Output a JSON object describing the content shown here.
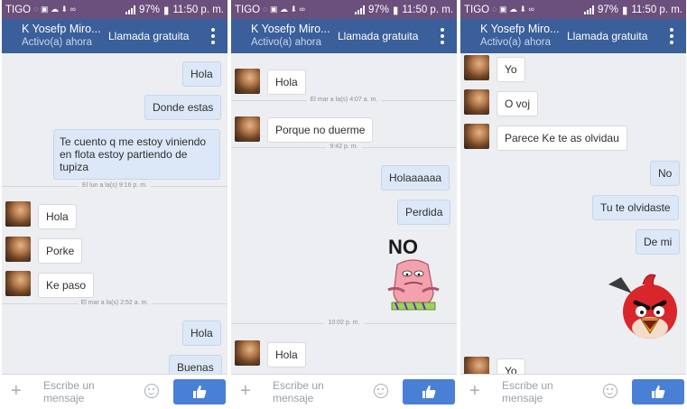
{
  "status_bar": {
    "carrier": "TIGO",
    "battery": "97%",
    "time": "11:50 p. m."
  },
  "header": {
    "name": "K Yosefp Miro...",
    "status": "Activo(a) ahora",
    "call": "Llamada gratuita"
  },
  "input": {
    "placeholder_line1": "Escribe un",
    "placeholder_line2": "mensaje"
  },
  "panel1": {
    "out_1": "Hola",
    "out_2": "Donde estas",
    "out_3": "Te cuento q me estoy viniendo en flota estoy partiendo de tupiza",
    "divider_1": "El lun a la(s) 9:16 p. m.",
    "in_1": "Hola",
    "in_2": "Porke",
    "in_3": "Ke paso",
    "divider_2": "El mar a la(s) 2:52 a. m.",
    "out_4": "Hola",
    "out_5": "Buenas"
  },
  "panel2": {
    "in_1": "Hola",
    "divider_1": "El mar a la(s) 4:07 a. m.",
    "in_2": "Porque no duerme",
    "divider_2": "9:42 p. m.",
    "out_1": "Holaaaaaa",
    "out_2": "Perdida",
    "sticker_text": "NO",
    "divider_3": "10:02 p. m.",
    "in_3": "Hola"
  },
  "panel3": {
    "in_1": "Yo",
    "in_2": "O voj",
    "in_3": "Parece Ke te as olvidau",
    "out_1": "No",
    "out_2": "Tu te olvidaste",
    "out_3": "De mi",
    "in_4": "Yo"
  },
  "icons": [
    "plus-icon",
    "emoji-icon",
    "thumbs-up-icon",
    "more-vert-icon",
    "signal-icon"
  ]
}
